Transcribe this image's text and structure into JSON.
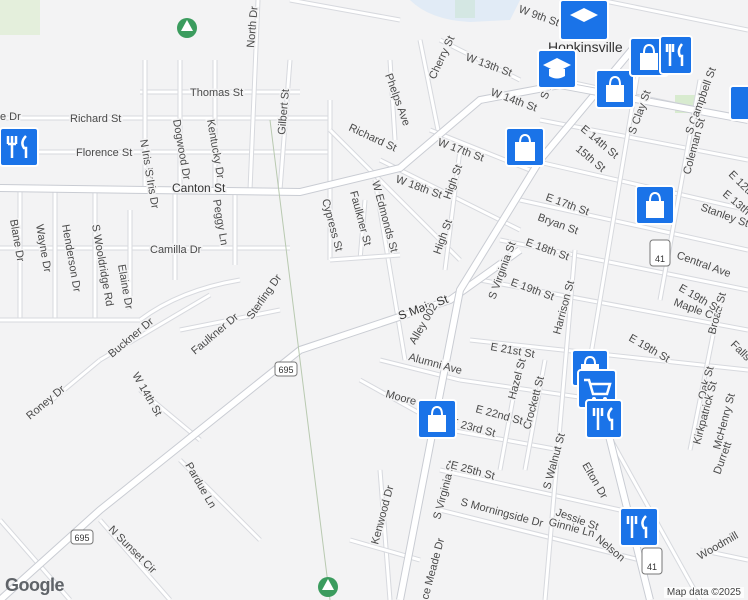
{
  "map": {
    "streets": [
      "W 9th St",
      "W 13th St",
      "W 14th St",
      "W 17th St",
      "W 18th St",
      "W Edmonds St",
      "Cherry St",
      "Phelps Ave",
      "Richard St",
      "Thomas St",
      "Florence St",
      "Canton St",
      "Camilla Dr",
      "Gilbert St",
      "North Dr",
      "Cypress St",
      "Faulkner St",
      "High St",
      "S Main St",
      "S Virginia St",
      "Alley 002",
      "Alumni Ave",
      "Moore",
      "Kenwood Dr",
      "S Morningside Dr",
      "E 25th St",
      "E 23rd St",
      "E 22nd St",
      "E 21st St",
      "E 19th St",
      "E 18th St",
      "E 17th St",
      "Bryan St",
      "Harrison St",
      "Hazel St",
      "Crockett St",
      "S Walnut St",
      "Elton Dr",
      "Jessie St",
      "Ginnie Ln",
      "Nelson",
      "15th St",
      "E 14th St",
      "S Clay St",
      "S Campbell St",
      "Coleman St",
      "Stanley St",
      "Central Ave",
      "Maple Ct",
      "Broad St",
      "Oak St",
      "Kirkpatrick St",
      "McHenry St",
      "Durrett",
      "Falls",
      "Woodmill",
      "E 12th",
      "E 13th St",
      "Blane Dr",
      "Wayne Dr",
      "Henderson Dr",
      "S Wooldridge Rd",
      "Elaine Dr",
      "N Iris Dr",
      "S Iris Dr",
      "Dogwood Dr",
      "Kentucky Dr",
      "Peggy Ln",
      "Buckner Dr",
      "Faulkner Dr",
      "Sterling Dr",
      "Roney Dr",
      "Pardue Ln",
      "N Sunset Cir",
      "Iris Dr",
      "ce Meade Dr",
      "S Ma"
    ],
    "partial_labels": [
      "e Dr",
      "E 12th",
      "E 13th St",
      "Falls",
      "Durrett",
      "Woodmill"
    ],
    "route_shields": [
      "695",
      "695",
      "41",
      "41"
    ],
    "city_label": "Hopkinsville",
    "pins": [
      "restaurant",
      "shopping",
      "shopping",
      "shopping",
      "education",
      "shopping",
      "restaurant",
      "grocery",
      "restaurant",
      "shopping",
      "restaurant"
    ]
  },
  "attribution": "Map data ©2025",
  "logo": "Google"
}
